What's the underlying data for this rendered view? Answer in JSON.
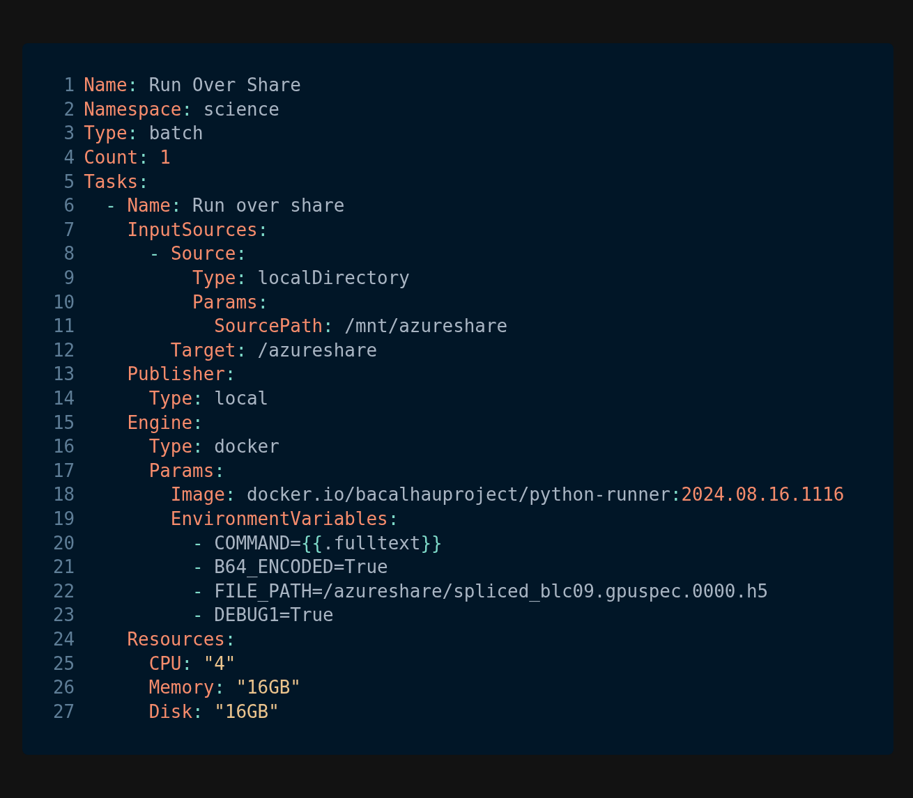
{
  "code_block": {
    "lines": [
      {
        "number": "1",
        "tokens": [
          {
            "kind": "key",
            "text": "Name"
          },
          {
            "kind": "punct",
            "text": ": "
          },
          {
            "kind": "plain",
            "text": "Run Over Share"
          }
        ]
      },
      {
        "number": "2",
        "tokens": [
          {
            "kind": "key",
            "text": "Namespace"
          },
          {
            "kind": "punct",
            "text": ": "
          },
          {
            "kind": "plain",
            "text": "science"
          }
        ]
      },
      {
        "number": "3",
        "tokens": [
          {
            "kind": "key",
            "text": "Type"
          },
          {
            "kind": "punct",
            "text": ": "
          },
          {
            "kind": "plain",
            "text": "batch"
          }
        ]
      },
      {
        "number": "4",
        "tokens": [
          {
            "kind": "key",
            "text": "Count"
          },
          {
            "kind": "punct",
            "text": ": "
          },
          {
            "kind": "number",
            "text": "1"
          }
        ]
      },
      {
        "number": "5",
        "tokens": [
          {
            "kind": "key",
            "text": "Tasks"
          },
          {
            "kind": "punct",
            "text": ":"
          }
        ]
      },
      {
        "number": "6",
        "tokens": [
          {
            "kind": "punct",
            "text": "  - "
          },
          {
            "kind": "key",
            "text": "Name"
          },
          {
            "kind": "punct",
            "text": ": "
          },
          {
            "kind": "plain",
            "text": "Run over share"
          }
        ]
      },
      {
        "number": "7",
        "tokens": [
          {
            "kind": "key",
            "text": "    InputSources"
          },
          {
            "kind": "punct",
            "text": ":"
          }
        ]
      },
      {
        "number": "8",
        "tokens": [
          {
            "kind": "punct",
            "text": "      - "
          },
          {
            "kind": "key",
            "text": "Source"
          },
          {
            "kind": "punct",
            "text": ":"
          }
        ]
      },
      {
        "number": "9",
        "tokens": [
          {
            "kind": "key",
            "text": "          Type"
          },
          {
            "kind": "punct",
            "text": ": "
          },
          {
            "kind": "plain",
            "text": "localDirectory"
          }
        ]
      },
      {
        "number": "10",
        "tokens": [
          {
            "kind": "key",
            "text": "          Params"
          },
          {
            "kind": "punct",
            "text": ":"
          }
        ]
      },
      {
        "number": "11",
        "tokens": [
          {
            "kind": "key",
            "text": "            SourcePath"
          },
          {
            "kind": "punct",
            "text": ": "
          },
          {
            "kind": "plain",
            "text": "/mnt/azureshare"
          }
        ]
      },
      {
        "number": "12",
        "tokens": [
          {
            "kind": "key",
            "text": "        Target"
          },
          {
            "kind": "punct",
            "text": ": "
          },
          {
            "kind": "plain",
            "text": "/azureshare"
          }
        ]
      },
      {
        "number": "13",
        "tokens": [
          {
            "kind": "key",
            "text": "    Publisher"
          },
          {
            "kind": "punct",
            "text": ":"
          }
        ]
      },
      {
        "number": "14",
        "tokens": [
          {
            "kind": "key",
            "text": "      Type"
          },
          {
            "kind": "punct",
            "text": ": "
          },
          {
            "kind": "plain",
            "text": "local"
          }
        ]
      },
      {
        "number": "15",
        "tokens": [
          {
            "kind": "key",
            "text": "    Engine"
          },
          {
            "kind": "punct",
            "text": ":"
          }
        ]
      },
      {
        "number": "16",
        "tokens": [
          {
            "kind": "key",
            "text": "      Type"
          },
          {
            "kind": "punct",
            "text": ": "
          },
          {
            "kind": "plain",
            "text": "docker"
          }
        ]
      },
      {
        "number": "17",
        "tokens": [
          {
            "kind": "key",
            "text": "      Params"
          },
          {
            "kind": "punct",
            "text": ":"
          }
        ]
      },
      {
        "number": "18",
        "tokens": [
          {
            "kind": "key",
            "text": "        Image"
          },
          {
            "kind": "punct",
            "text": ": "
          },
          {
            "kind": "plain",
            "text": "docker.io/bacalhauproject/python-runner"
          },
          {
            "kind": "punct",
            "text": ":"
          },
          {
            "kind": "number",
            "text": "2024.08.16.1116"
          }
        ]
      },
      {
        "number": "19",
        "tokens": [
          {
            "kind": "key",
            "text": "        EnvironmentVariables"
          },
          {
            "kind": "punct",
            "text": ":"
          }
        ]
      },
      {
        "number": "20",
        "tokens": [
          {
            "kind": "punct",
            "text": "          - "
          },
          {
            "kind": "plain",
            "text": "COMMAND="
          },
          {
            "kind": "punct",
            "text": "{{"
          },
          {
            "kind": "plain",
            "text": ".fulltext"
          },
          {
            "kind": "punct",
            "text": "}}"
          }
        ]
      },
      {
        "number": "21",
        "tokens": [
          {
            "kind": "punct",
            "text": "          - "
          },
          {
            "kind": "plain",
            "text": "B64_ENCODED=True"
          }
        ]
      },
      {
        "number": "22",
        "tokens": [
          {
            "kind": "punct",
            "text": "          - "
          },
          {
            "kind": "plain",
            "text": "FILE_PATH=/azureshare/spliced_blc09.gpuspec.0000.h5"
          }
        ]
      },
      {
        "number": "23",
        "tokens": [
          {
            "kind": "punct",
            "text": "          - "
          },
          {
            "kind": "plain",
            "text": "DEBUG1=True"
          }
        ]
      },
      {
        "number": "24",
        "tokens": [
          {
            "kind": "key",
            "text": "    Resources"
          },
          {
            "kind": "punct",
            "text": ":"
          }
        ]
      },
      {
        "number": "25",
        "tokens": [
          {
            "kind": "key",
            "text": "      CPU"
          },
          {
            "kind": "punct",
            "text": ": "
          },
          {
            "kind": "string",
            "text": "\"4\""
          }
        ]
      },
      {
        "number": "26",
        "tokens": [
          {
            "kind": "key",
            "text": "      Memory"
          },
          {
            "kind": "punct",
            "text": ": "
          },
          {
            "kind": "string",
            "text": "\"16GB\""
          }
        ]
      },
      {
        "number": "27",
        "tokens": [
          {
            "kind": "key",
            "text": "      Disk"
          },
          {
            "kind": "punct",
            "text": ": "
          },
          {
            "kind": "string",
            "text": "\"16GB\""
          }
        ]
      }
    ]
  }
}
